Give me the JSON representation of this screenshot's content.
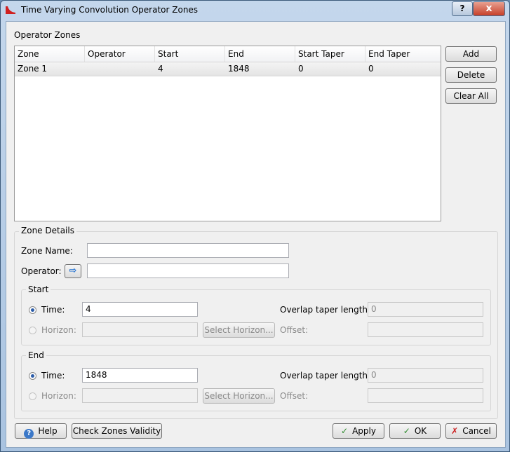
{
  "window": {
    "title": "Time Varying Convolution Operator Zones",
    "help_glyph": "?",
    "close_glyph": "x"
  },
  "zones": {
    "heading": "Operator Zones",
    "columns": [
      "Zone",
      "Operator",
      "Start",
      "End",
      "Start Taper",
      "End Taper"
    ],
    "rows": [
      {
        "zone": "Zone 1",
        "operator": "",
        "start": "4",
        "end": "1848",
        "start_taper": "0",
        "end_taper": "0"
      }
    ],
    "add_label": "Add",
    "delete_label": "Delete",
    "clear_label": "Clear All"
  },
  "details": {
    "heading": "Zone Details",
    "zone_name_label": "Zone Name:",
    "zone_name_value": "",
    "operator_label": "Operator:",
    "operator_value": "",
    "start": {
      "heading": "Start",
      "time_label": "Time:",
      "time_value": "4",
      "horizon_label": "Horizon:",
      "horizon_value": "",
      "select_horizon_label": "Select Horizon...",
      "overlap_label": "Overlap taper length:",
      "overlap_value": "0",
      "offset_label": "Offset:",
      "offset_value": ""
    },
    "end": {
      "heading": "End",
      "time_label": "Time:",
      "time_value": "1848",
      "horizon_label": "Horizon:",
      "horizon_value": "",
      "select_horizon_label": "Select Horizon...",
      "overlap_label": "Overlap taper length:",
      "overlap_value": "0",
      "offset_label": "Offset:",
      "offset_value": ""
    }
  },
  "footer": {
    "help_label": "Help",
    "check_label": "Check Zones Validity",
    "apply_label": "Apply",
    "ok_label": "OK",
    "cancel_label": "Cancel"
  },
  "colors": {
    "accent": "#2b5ca8",
    "close": "#c7402a",
    "check": "#2e8b2e",
    "cancel_x": "#cc2020"
  }
}
